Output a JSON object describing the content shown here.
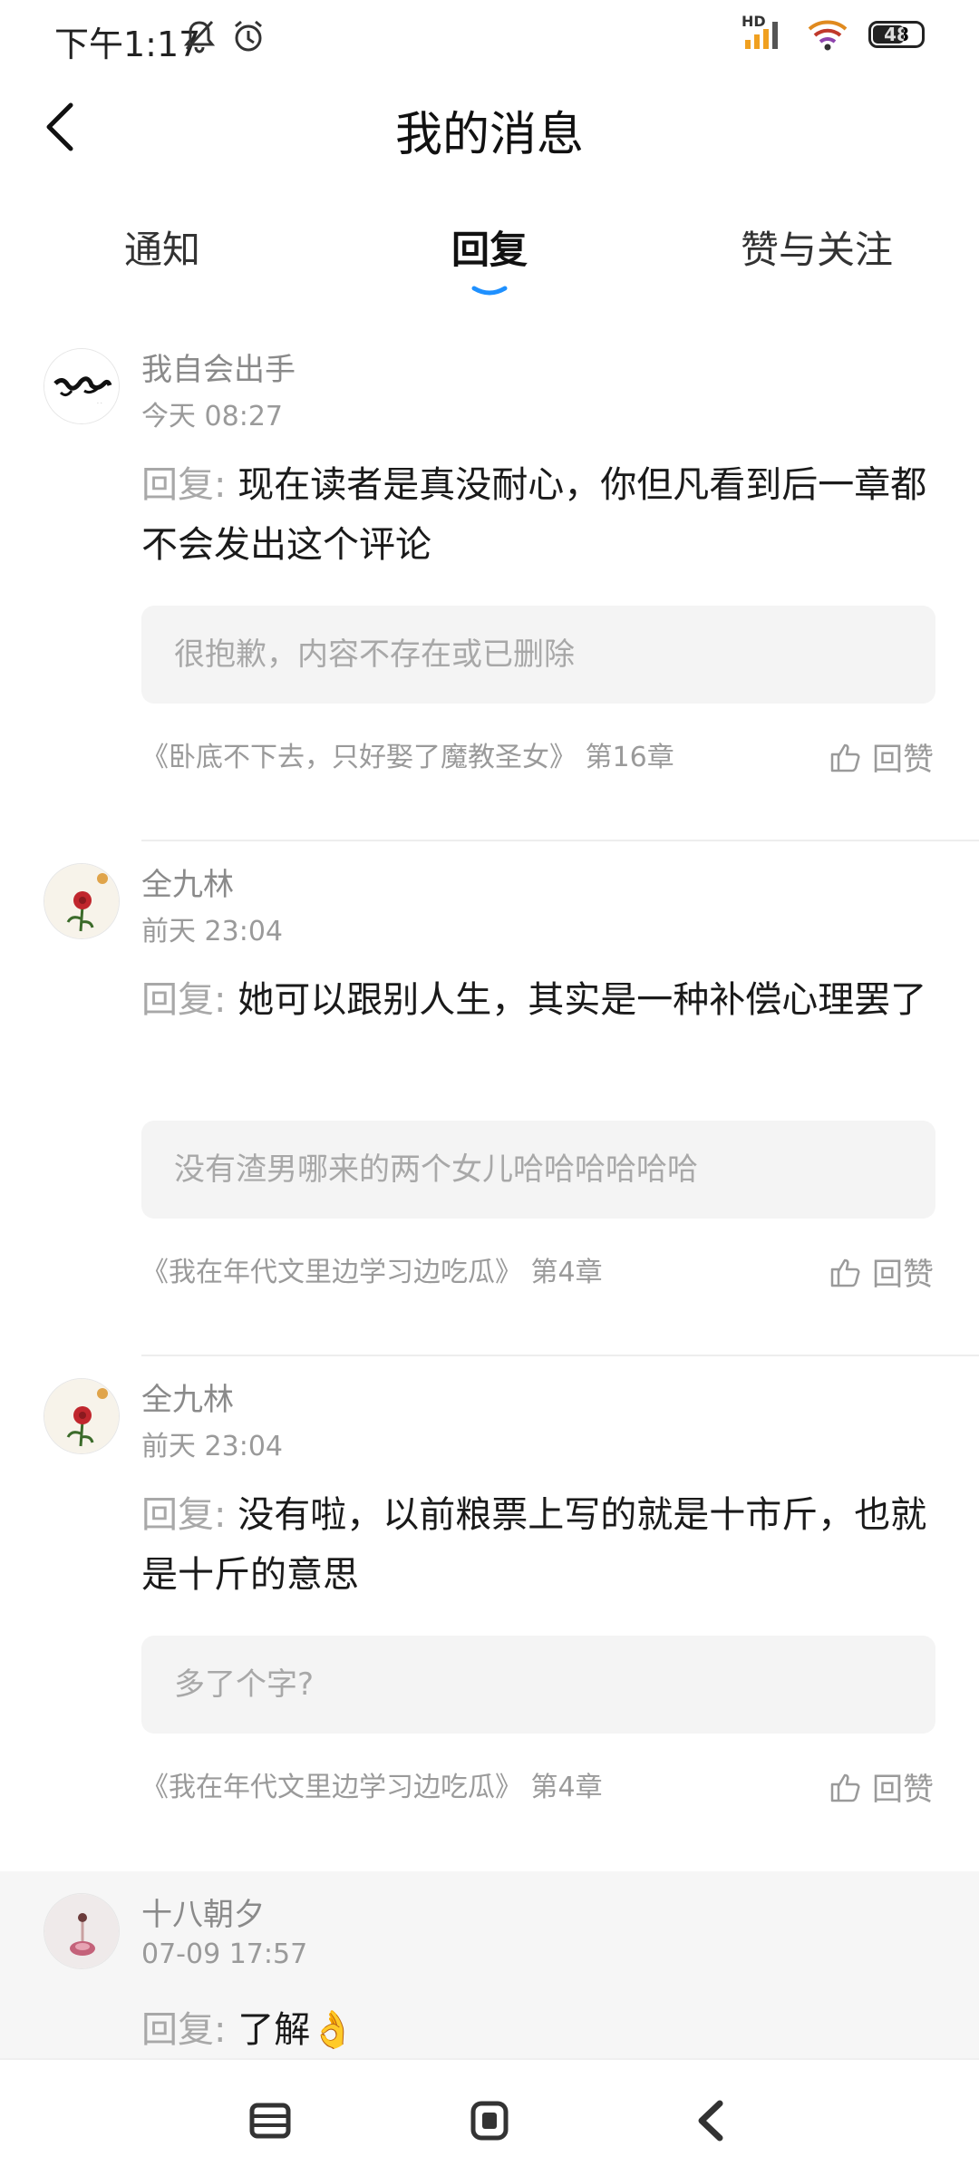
{
  "status_bar": {
    "time": "下午1:17",
    "battery": "48",
    "network_label": "HD",
    "icons": [
      "bell-muted-icon",
      "alarm-icon",
      "signal-icon",
      "wifi-icon",
      "battery-icon"
    ]
  },
  "header": {
    "title": "我的消息",
    "back_icon": "chevron-left-icon"
  },
  "tabs": [
    {
      "label": "通知",
      "active": false
    },
    {
      "label": "回复",
      "active": true
    },
    {
      "label": "赞与关注",
      "active": false
    }
  ],
  "accent_color": "#1e90ff",
  "messages": [
    {
      "username": "我自会出手",
      "time": "今天 08:27",
      "reply_prefix": "回复:",
      "reply_text": "现在读者是真没耐心，你但凡看到后一章都不会发出这个评论",
      "quote": "很抱歉，内容不存在或已删除",
      "source": "《卧底不下去，只好娶了魔教圣女》 第16章",
      "like_label": "回赞"
    },
    {
      "username": "全九林",
      "time": "前天 23:04",
      "reply_prefix": "回复:",
      "reply_text": "她可以跟别人生，其实是一种补偿心理罢了",
      "quote": "没有渣男哪来的两个女儿哈哈哈哈哈哈",
      "source": "《我在年代文里边学习边吃瓜》 第4章",
      "like_label": "回赞"
    },
    {
      "username": "全九林",
      "time": "前天 23:04",
      "reply_prefix": "回复:",
      "reply_text": "没有啦，以前粮票上写的就是十市斤，也就是十斤的意思",
      "quote": "多了个字?",
      "source": "《我在年代文里边学习边吃瓜》 第4章",
      "like_label": "回赞"
    },
    {
      "username": "十八朝夕",
      "time": "07-09 17:57",
      "reply_prefix": "回复:",
      "reply_text": "了解👌",
      "quote": "",
      "source": "",
      "like_label": ""
    }
  ],
  "nav_bar": {
    "icons": [
      "menu-icon",
      "home-icon",
      "back-icon"
    ]
  }
}
